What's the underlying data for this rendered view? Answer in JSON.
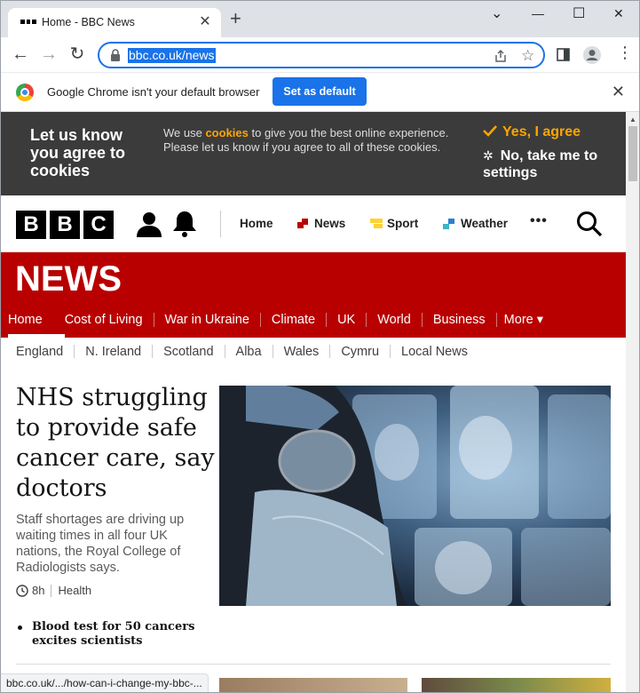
{
  "browser": {
    "tab_title": "Home - BBC News",
    "url": "bbc.co.uk/news",
    "window_minimize": "—",
    "window_maximize": "☐",
    "window_close": "✕",
    "chevron": "⌄"
  },
  "infobar": {
    "message": "Google Chrome isn't your default browser",
    "set_default_label": "Set as default"
  },
  "cookie_banner": {
    "title": "Let us know you agree to cookies",
    "msg_prefix": "We use ",
    "msg_link": "cookies",
    "msg_suffix": " to give you the best online experience. Please let us know if you agree to all of these cookies.",
    "agree_label": "Yes, I agree",
    "settings_label": "No, take me to settings"
  },
  "bbc_nav": {
    "logo_letters": [
      "B",
      "B",
      "C"
    ],
    "home": "Home",
    "news": "News",
    "sport": "Sport",
    "weather": "Weather",
    "more": "•••"
  },
  "news_header": {
    "title": "NEWS",
    "nav": [
      "Home",
      "Cost of Living",
      "War in Ukraine",
      "Climate",
      "UK",
      "World",
      "Business",
      "More ▾"
    ]
  },
  "sub_nav": [
    "England",
    "N. Ireland",
    "Scotland",
    "Alba",
    "Wales",
    "Cymru",
    "Local News"
  ],
  "top_story": {
    "headline": "NHS struggling to provide safe cancer care, say doctors",
    "summary": "Staff shortages are driving up waiting times in all four UK nations, the Royal College of Radiologists says.",
    "time": "8h",
    "tag": "Health",
    "related": "Blood test for 50 cancers excites scientists"
  },
  "status_url": "bbc.co.uk/.../how-can-i-change-my-bbc-..."
}
